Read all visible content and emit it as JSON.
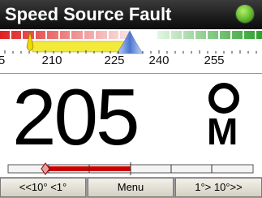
{
  "title_bar": {
    "title": "Speed Source Fault",
    "status_led_color": "#5fb82a"
  },
  "scale_tape": {
    "ticks": [
      {
        "label": "5"
      },
      {
        "label": "210"
      },
      {
        "label": "225"
      },
      {
        "label": "240"
      },
      {
        "label": "255"
      }
    ],
    "port_color": "#e02020",
    "starboard_color": "#2ca02c",
    "track_band_color": "#f3e93a",
    "pointer_color": "#6a8fd8"
  },
  "readout": {
    "heading": "205",
    "reference": "M"
  },
  "error_bar": {
    "fill_color": "#cc0000"
  },
  "softkeys": {
    "left": "<<10°  <1°",
    "center": "Menu",
    "right": "1°>  10°>>"
  }
}
